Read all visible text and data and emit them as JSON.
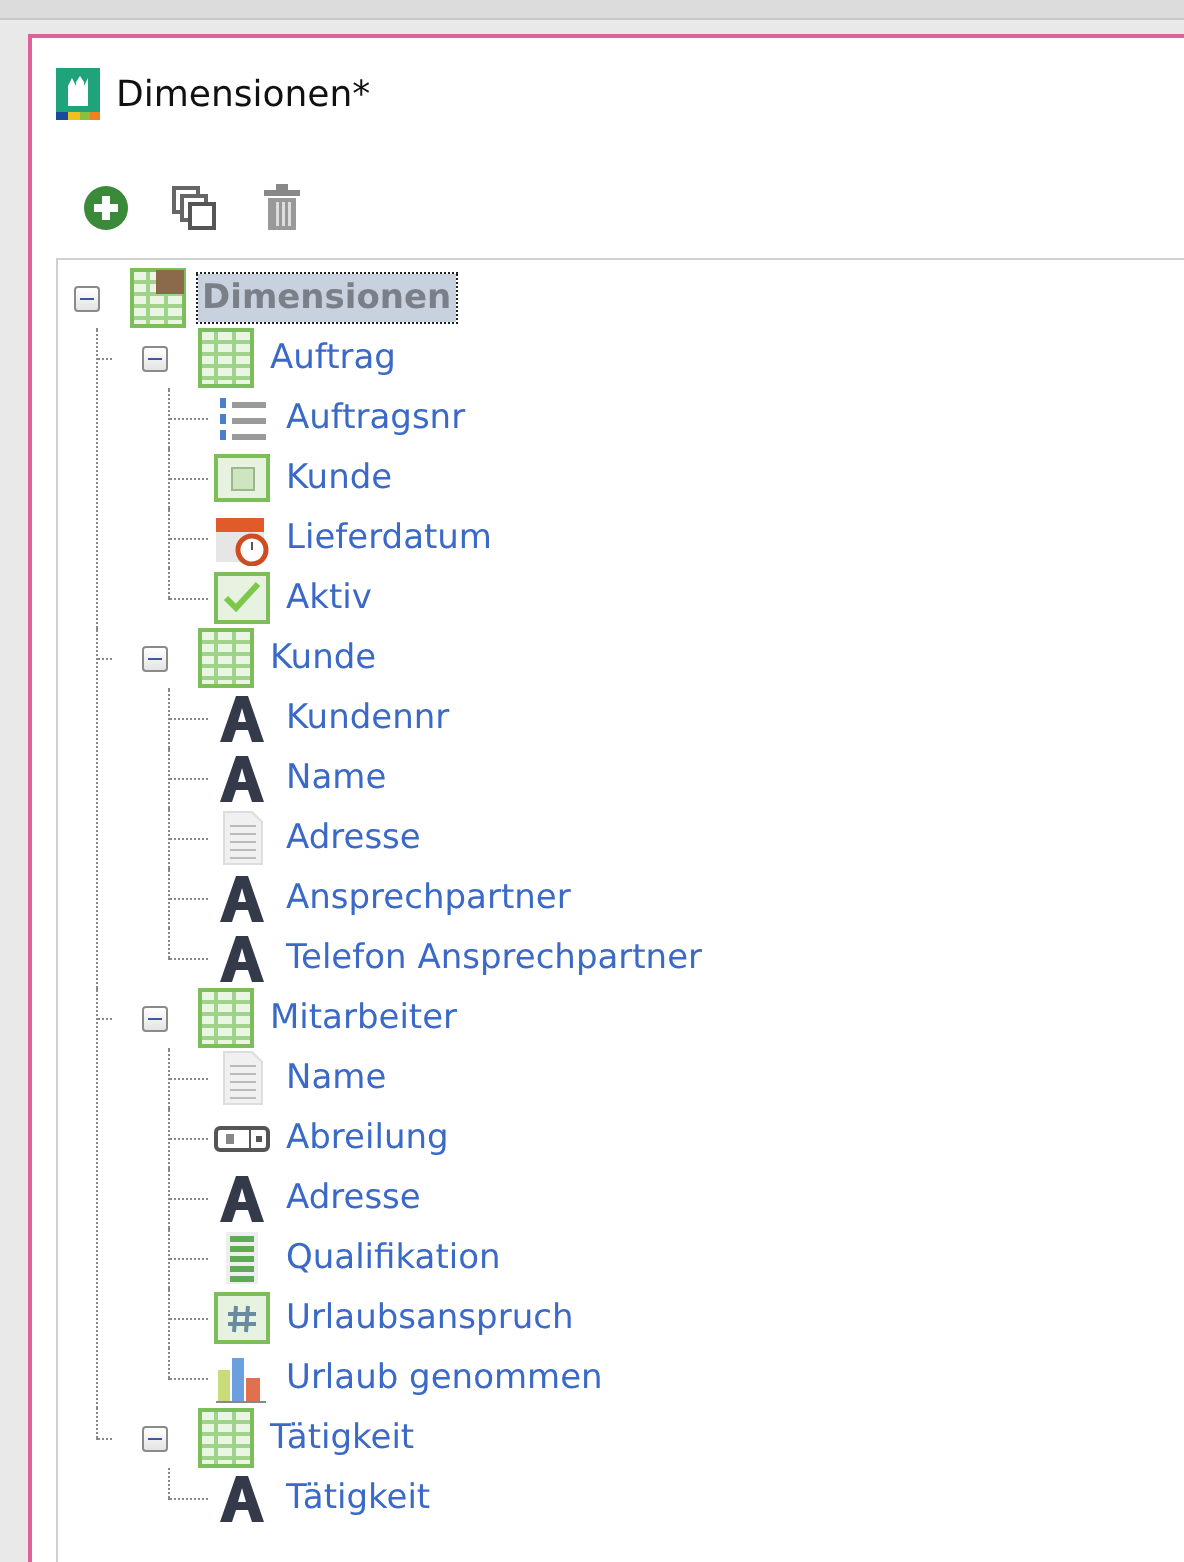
{
  "window": {
    "title": "Dimensionen*"
  },
  "toolbar": [
    {
      "kind": "add"
    },
    {
      "kind": "copy"
    },
    {
      "kind": "delete"
    }
  ],
  "tree": {
    "label": "Dimensionen",
    "kind": "root",
    "expanded": true,
    "selected": true,
    "children": [
      {
        "label": "Auftrag",
        "kind": "table",
        "expanded": true,
        "selected": false,
        "children": [
          {
            "label": "Auftragsnr",
            "kind": "list",
            "selected": false
          },
          {
            "label": "Kunde",
            "kind": "lookup",
            "selected": false
          },
          {
            "label": "Lieferdatum",
            "kind": "date",
            "selected": false
          },
          {
            "label": "Aktiv",
            "kind": "checkbox",
            "selected": false
          }
        ]
      },
      {
        "label": "Kunde",
        "kind": "table",
        "expanded": true,
        "selected": false,
        "children": [
          {
            "label": "Kundennr",
            "kind": "text",
            "selected": false
          },
          {
            "label": "Name",
            "kind": "text",
            "selected": false
          },
          {
            "label": "Adresse",
            "kind": "memo",
            "selected": false
          },
          {
            "label": "Ansprechpartner",
            "kind": "text",
            "selected": false
          },
          {
            "label": "Telefon Ansprechpartner",
            "kind": "text",
            "selected": false
          }
        ]
      },
      {
        "label": "Mitarbeiter",
        "kind": "table",
        "expanded": true,
        "selected": false,
        "children": [
          {
            "label": "Name",
            "kind": "memo",
            "selected": false
          },
          {
            "label": "Abreilung",
            "kind": "dropdown",
            "selected": false
          },
          {
            "label": "Adresse",
            "kind": "text",
            "selected": false
          },
          {
            "label": "Qualifikation",
            "kind": "grid",
            "selected": false
          },
          {
            "label": "Urlaubsanspruch",
            "kind": "number",
            "selected": false
          },
          {
            "label": "Urlaub genommen",
            "kind": "chart",
            "selected": false
          }
        ]
      },
      {
        "label": "Tätigkeit",
        "kind": "table",
        "expanded": true,
        "selected": false,
        "children": [
          {
            "label": "Tätigkeit",
            "kind": "text",
            "selected": false
          }
        ]
      }
    ]
  }
}
